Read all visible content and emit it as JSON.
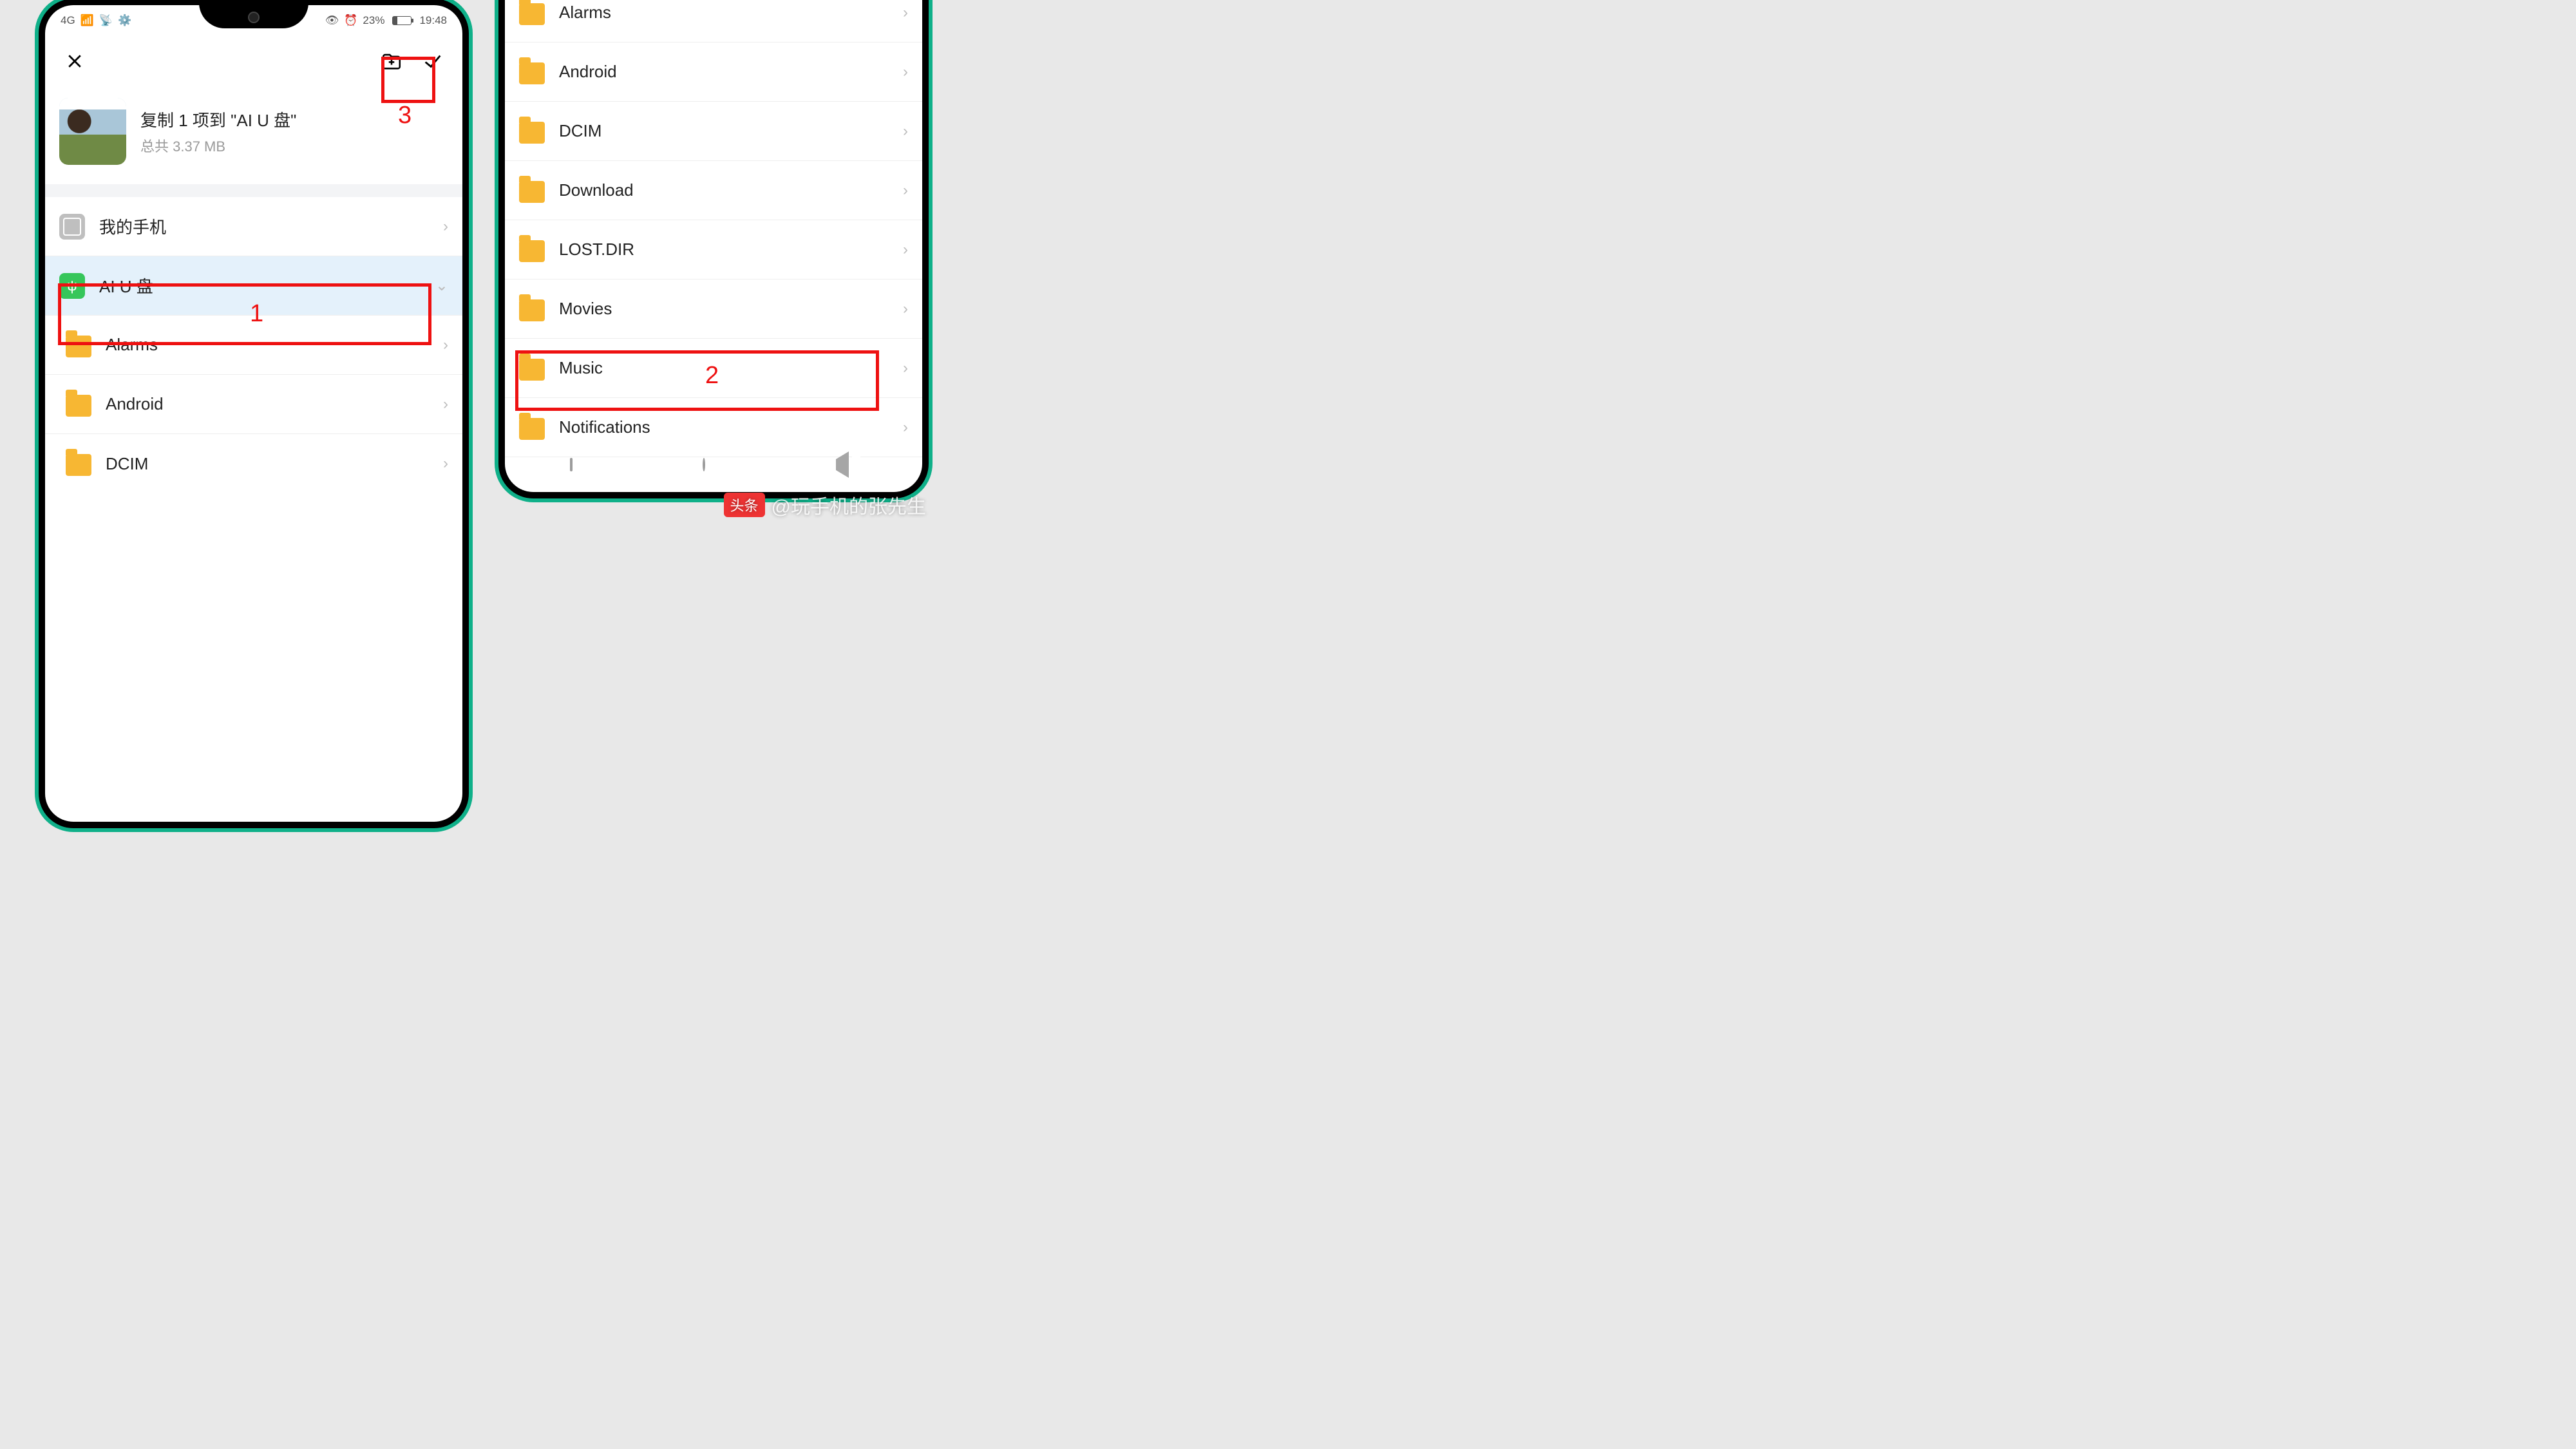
{
  "statusbar": {
    "network": "4G",
    "battery_pct": "23%",
    "time": "19:48"
  },
  "copy": {
    "title": "复制 1 项到 \"AI U 盘\"",
    "subtitle": "总共 3.37 MB"
  },
  "destinations": {
    "phone": "我的手机",
    "usb": "AI U 盘"
  },
  "left_folders": [
    "Alarms",
    "Android",
    "DCIM"
  ],
  "right_folders": [
    "Alarms",
    "Android",
    "DCIM",
    "Download",
    "LOST.DIR",
    "Movies",
    "Music",
    "Notifications"
  ],
  "annotations": {
    "n1": "1",
    "n2": "2",
    "n3": "3"
  },
  "watermark": {
    "badge": "头条",
    "handle": "@玩手机的张先生"
  }
}
